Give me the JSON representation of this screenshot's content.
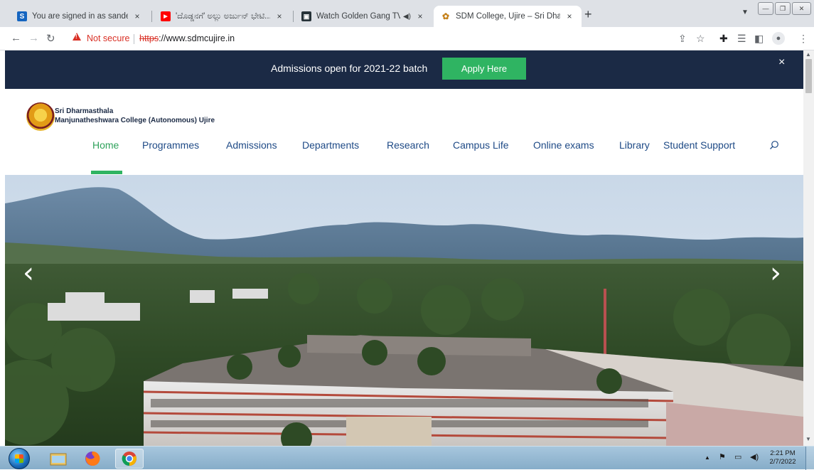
{
  "browser": {
    "tabs": [
      {
        "title": "You are signed in as sandeep.l",
        "favicon": "S",
        "favicon_color": "#1565c0"
      },
      {
        "title": "'ದೊಡ್ಡನಗೆ' ಅಲ್ಲು ಅರ್ಜುನ್ ಭೇಟಿ... ಕಂಡ್",
        "favicon": "▶",
        "favicon_color": "#ff0000"
      },
      {
        "title": "Watch Golden Gang TV Serial",
        "favicon": "▣",
        "favicon_color": "#263238"
      },
      {
        "title": "SDM College, Ujire – Sri Dharmasthala",
        "favicon": "✿",
        "favicon_color": "#c47f17"
      }
    ],
    "new_tab": "+",
    "tab_close": "×",
    "audio_icon": "◀)",
    "address": {
      "security_label": "Not secure",
      "url_scheme": "https",
      "url_rest": "://www.sdmcujire.in"
    }
  },
  "page": {
    "banner": {
      "text": "Admissions open for 2021-22 batch",
      "button": "Apply Here",
      "close": "×"
    },
    "college": {
      "line1": "Sri Dharmasthala",
      "line2": "Manjunatheshwara College (Autonomous) Ujire"
    },
    "nav": [
      "Home",
      "Programmes",
      "Admissions",
      "Departments",
      "Research",
      "Campus Life",
      "Online exams",
      "Library",
      "Student Support"
    ],
    "hero_prev": "‹",
    "hero_next": "›"
  },
  "taskbar": {
    "time": "2:21 PM",
    "date": "2/7/2022"
  }
}
